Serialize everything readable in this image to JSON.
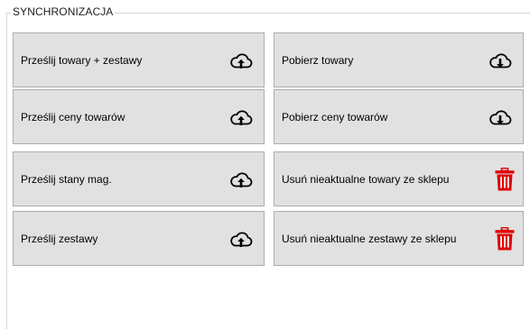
{
  "sync": {
    "title": "SYNCHRONIZACJA",
    "buttons": [
      {
        "label": "Prześlij towary + zestawy",
        "icon": "cloud-upload-icon"
      },
      {
        "label": "Pobierz towary",
        "icon": "cloud-download-icon"
      },
      {
        "label": "Prześlij ceny towarów",
        "icon": "cloud-upload-icon"
      },
      {
        "label": "Pobierz ceny towarów",
        "icon": "cloud-download-icon"
      },
      {
        "label": "Prześlij stany mag.",
        "icon": "cloud-upload-icon"
      },
      {
        "label": "Usuń nieaktualne towary ze sklepu",
        "icon": "trash-icon"
      },
      {
        "label": "Prześlij zestawy",
        "icon": "cloud-upload-icon"
      },
      {
        "label": "Usuń nieaktualne zestawy ze sklepu",
        "icon": "trash-icon"
      }
    ]
  },
  "colors": {
    "button_face": "#e1e1e1",
    "button_border": "#adadad",
    "trash_red": "#e00000"
  }
}
